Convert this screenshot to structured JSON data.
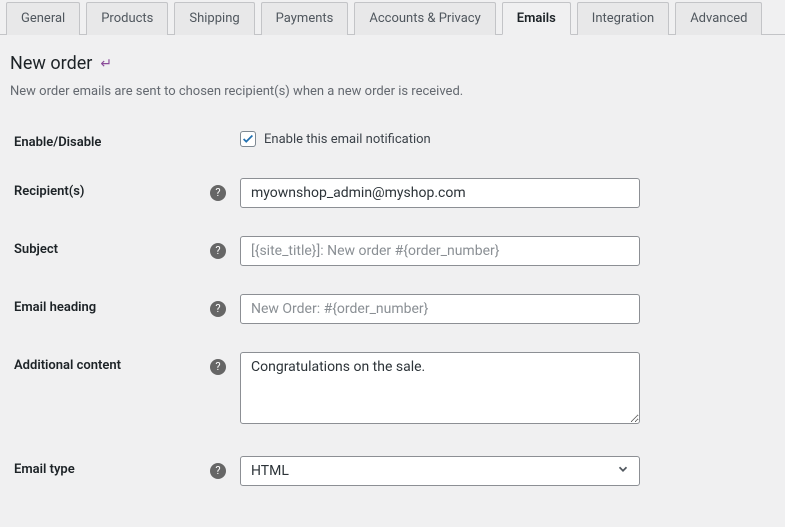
{
  "tabs": {
    "general": "General",
    "products": "Products",
    "shipping": "Shipping",
    "payments": "Payments",
    "accounts": "Accounts & Privacy",
    "emails": "Emails",
    "integration": "Integration",
    "advanced": "Advanced"
  },
  "page": {
    "title": "New order",
    "back_glyph": "↵",
    "description": "New order emails are sent to chosen recipient(s) when a new order is received."
  },
  "fields": {
    "enable": {
      "label": "Enable/Disable",
      "checkbox_label": "Enable this email notification",
      "checked": true
    },
    "recipients": {
      "label": "Recipient(s)",
      "value": "myownshop_admin@myshop.com"
    },
    "subject": {
      "label": "Subject",
      "placeholder": "[{site_title}]: New order #{order_number}"
    },
    "heading": {
      "label": "Email heading",
      "placeholder": "New Order: #{order_number}"
    },
    "additional": {
      "label": "Additional content",
      "value": "Congratulations on the sale."
    },
    "email_type": {
      "label": "Email type",
      "selected": "HTML"
    }
  },
  "help_glyph": "?"
}
